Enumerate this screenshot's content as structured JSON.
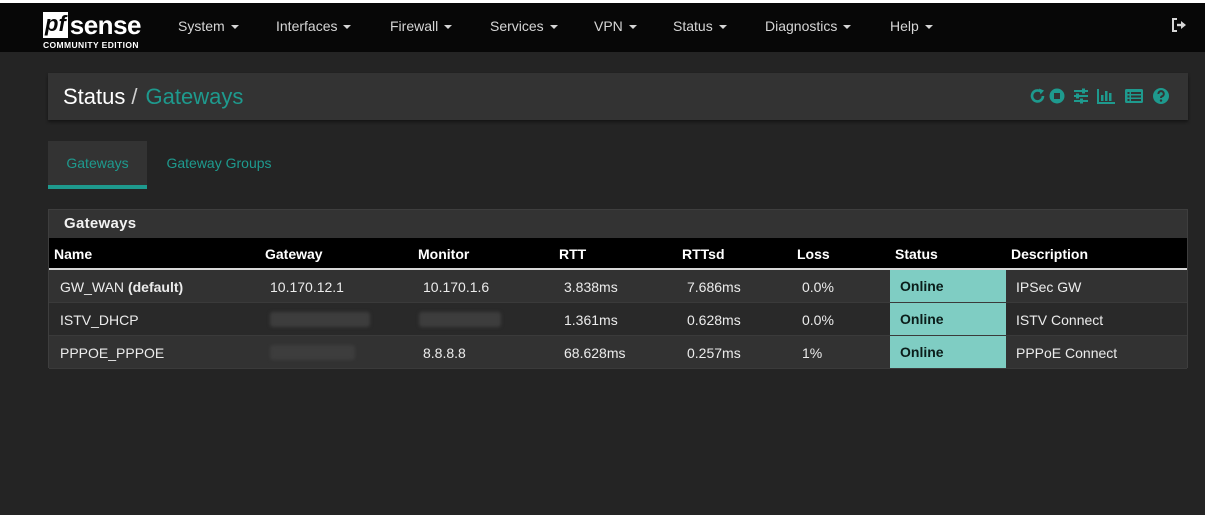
{
  "brand": {
    "logo_pf": "pf",
    "logo_sense": "sense",
    "logo_subtitle": "COMMUNITY EDITION"
  },
  "nav": {
    "items": [
      {
        "label": "System"
      },
      {
        "label": "Interfaces"
      },
      {
        "label": "Firewall"
      },
      {
        "label": "Services"
      },
      {
        "label": "VPN"
      },
      {
        "label": "Status"
      },
      {
        "label": "Diagnostics"
      },
      {
        "label": "Help"
      }
    ],
    "logout_icon": "sign-out-icon"
  },
  "breadcrumb": {
    "section": "Status",
    "separator": "/",
    "page": "Gateways"
  },
  "header_icons": [
    "refresh-icon",
    "stop-circle-icon",
    "sliders-icon",
    "bar-chart-icon",
    "list-alt-icon",
    "question-circle-icon"
  ],
  "tabs": [
    {
      "label": "Gateways",
      "active": true
    },
    {
      "label": "Gateway Groups",
      "active": false
    }
  ],
  "panel": {
    "title": "Gateways",
    "columns": [
      "Name",
      "Gateway",
      "Monitor",
      "RTT",
      "RTTsd",
      "Loss",
      "Status",
      "Description"
    ],
    "rows": [
      {
        "name": "GW_WAN",
        "name_suffix": "(default)",
        "gateway": "10.170.12.1",
        "monitor": "10.170.1.6",
        "rtt": "3.838ms",
        "rttsd": "7.686ms",
        "loss": "0.0%",
        "status": "Online",
        "description": "IPSec GW"
      },
      {
        "name": "ISTV_DHCP",
        "name_suffix": "",
        "gateway": "",
        "monitor": "",
        "rtt": "1.361ms",
        "rttsd": "0.628ms",
        "loss": "0.0%",
        "status": "Online",
        "description": "ISTV Connect"
      },
      {
        "name": "PPPOE_PPPOE",
        "name_suffix": "",
        "gateway": "",
        "monitor": "8.8.8.8",
        "rtt": "68.628ms",
        "rttsd": "0.257ms",
        "loss": "1%",
        "status": "Online",
        "description": "PPPoE Connect"
      }
    ]
  },
  "colors": {
    "accent": "#1e9a8e",
    "status_online": "#7fcdc3",
    "navbar": "#070707",
    "background": "#242424"
  }
}
